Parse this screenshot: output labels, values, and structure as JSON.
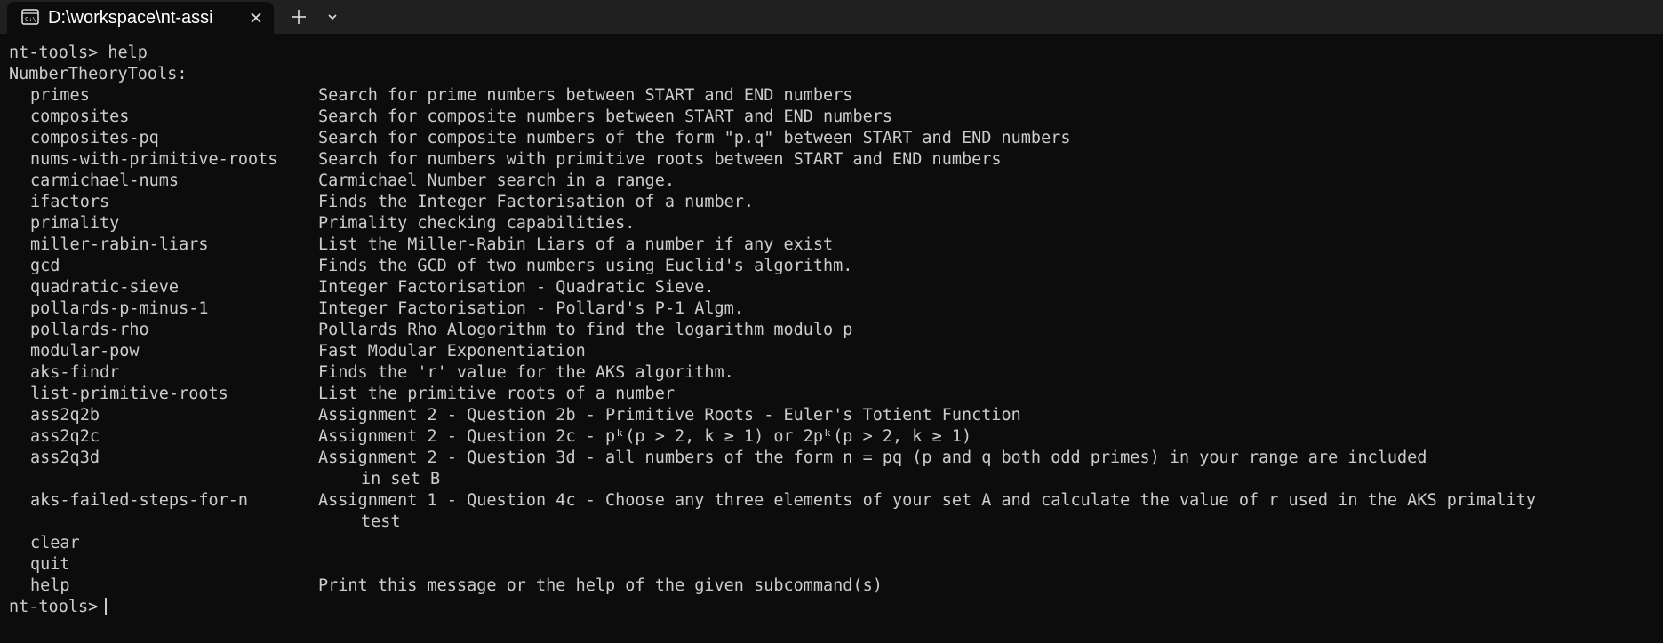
{
  "tab": {
    "title": "D:\\workspace\\nt-assi",
    "icon": "terminal-icon",
    "close_icon": "close-icon",
    "new_tab_icon": "plus-icon",
    "dropdown_icon": "chevron-down-icon"
  },
  "terminal": {
    "first_line": "nt-tools> help",
    "heading": "NumberTheoryTools:",
    "commands": [
      {
        "name": "primes",
        "desc": "Search for prime numbers between START and END numbers"
      },
      {
        "name": "composites",
        "desc": "Search for composite numbers between START and END numbers"
      },
      {
        "name": "composites-pq",
        "desc": "Search for composite numbers of the form \"p.q\" between START and END numbers"
      },
      {
        "name": "nums-with-primitive-roots",
        "desc": "Search for numbers with primitive roots between START and END numbers"
      },
      {
        "name": "carmichael-nums",
        "desc": "Carmichael Number search in a range."
      },
      {
        "name": "ifactors",
        "desc": "Finds the Integer Factorisation of a number."
      },
      {
        "name": "primality",
        "desc": "Primality checking capabilities."
      },
      {
        "name": "miller-rabin-liars",
        "desc": "List the Miller-Rabin Liars of a number if any exist"
      },
      {
        "name": "gcd",
        "desc": "Finds the GCD of two numbers using Euclid's algorithm."
      },
      {
        "name": "quadratic-sieve",
        "desc": "Integer Factorisation - Quadratic Sieve."
      },
      {
        "name": "pollards-p-minus-1",
        "desc": "Integer Factorisation - Pollard's P-1 Algm."
      },
      {
        "name": "pollards-rho",
        "desc": "Pollards Rho Alogorithm to find the logarithm modulo p"
      },
      {
        "name": "modular-pow",
        "desc": "Fast Modular Exponentiation"
      },
      {
        "name": "aks-findr",
        "desc": "Finds the 'r' value for the AKS algorithm."
      },
      {
        "name": "list-primitive-roots",
        "desc": "List the primitive roots of a number"
      },
      {
        "name": "ass2q2b",
        "desc": "Assignment 2 - Question 2b - Primitive Roots - Euler's Totient Function"
      },
      {
        "name": "ass2q2c",
        "desc": "Assignment 2 - Question 2c - pᵏ(p > 2, k ≥ 1) or 2pᵏ(p > 2, k ≥ 1)"
      },
      {
        "name": "ass2q3d",
        "desc": "Assignment 2 - Question 3d - all numbers of the form n = pq (p and q both odd primes) in your range are included",
        "cont": "in set B"
      },
      {
        "name": "aks-failed-steps-for-n",
        "desc": "Assignment 1 - Question 4c - Choose any three elements of your set A and calculate the value of r used in the AKS primality",
        "cont": "test"
      },
      {
        "name": "clear",
        "desc": ""
      },
      {
        "name": "quit",
        "desc": ""
      },
      {
        "name": "help",
        "desc": "Print this message or the help of the given subcommand(s)"
      }
    ],
    "prompt": "nt-tools>"
  },
  "colors": {
    "background": "#0c0c0c",
    "titlebar": "#202020",
    "text": "#cccccc"
  }
}
